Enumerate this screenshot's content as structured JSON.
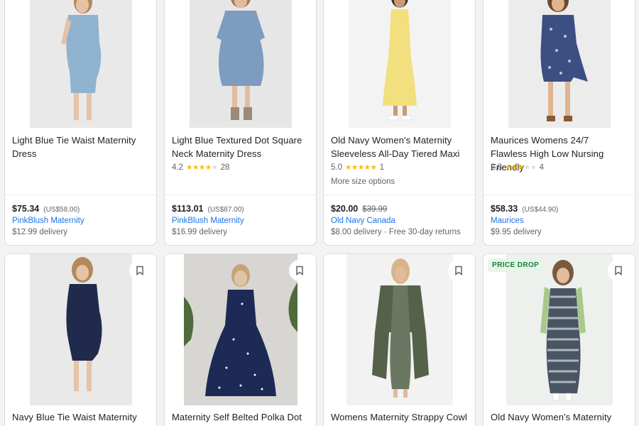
{
  "products": [
    {
      "title": "Light Blue Tie Waist Maternity Dress",
      "price": "$75.34",
      "orig": "(US$58.00)",
      "store": "PinkBlush Maternity",
      "delivery": "$12.99 delivery",
      "rating": null,
      "reviews": null,
      "more": null,
      "colors": {
        "bg": "#e9e9ea",
        "dress": "#8fb3cf",
        "skin": "#e6c2a6",
        "hair": "#b5895b"
      }
    },
    {
      "title": "Light Blue Textured Dot Square Neck Maternity Dress",
      "price": "$113.01",
      "orig": "(US$87.00)",
      "store": "PinkBlush Maternity",
      "delivery": "$16.99 delivery",
      "rating": "4.2",
      "stars": 4,
      "reviews": "28",
      "more": null,
      "colors": {
        "bg": "#e6e6e7",
        "dress": "#7d9cbf",
        "skin": "#e3bca0",
        "hair": "#a97b4f"
      }
    },
    {
      "title": "Old Navy Women's Maternity Sleeveless All-Day Tiered Maxi",
      "price": "$20.00",
      "orig": "$39.99",
      "store": "Old Navy Canada",
      "delivery": "$8.00 delivery · Free 30-day returns",
      "rating": "5.0",
      "stars": 5,
      "reviews": "1",
      "more": "More size options",
      "colors": {
        "bg": "#f3f3f3",
        "dress": "#f2df7e",
        "skin": "#c79a78",
        "hair": "#4a3325"
      }
    },
    {
      "title": "Maurices Womens 24/7 Flawless High Low Nursing Friendly",
      "price": "$58.33",
      "orig": "(US$44.90)",
      "store": "Maurices",
      "delivery": "$9.95 delivery",
      "rating": "2.8",
      "stars": 3,
      "reviews": "4",
      "more": null,
      "colors": {
        "bg": "#ececec",
        "dress": "#3c4f83",
        "skin": "#e0b491",
        "hair": "#6b4a30"
      }
    },
    {
      "title": "Navy Blue Tie Waist Maternity",
      "badge": null,
      "colors": {
        "bg": "#e9e9ea",
        "dress": "#1f2a4d",
        "skin": "#e6c2a6",
        "hair": "#b5895b"
      }
    },
    {
      "title": "Maternity Self Belted Polka Dot",
      "badge": null,
      "colors": {
        "bg": "#d8d6d2",
        "dress": "#1d2a55",
        "skin": "#e2c3a8",
        "hair": "#c4a477"
      }
    },
    {
      "title": "Womens Maternity Strappy Cowl",
      "badge": null,
      "colors": {
        "bg": "#f2f2f2",
        "dress": "#56614a",
        "skin": "#e2b99d",
        "hair": "#d6b688"
      }
    },
    {
      "title": "Old Navy Women's Maternity",
      "badge": "PRICE DROP",
      "colors": {
        "bg": "#eef0ee",
        "dress": "#4a5563",
        "skin": "#e3bc9e",
        "hair": "#7a5a3e"
      }
    }
  ]
}
